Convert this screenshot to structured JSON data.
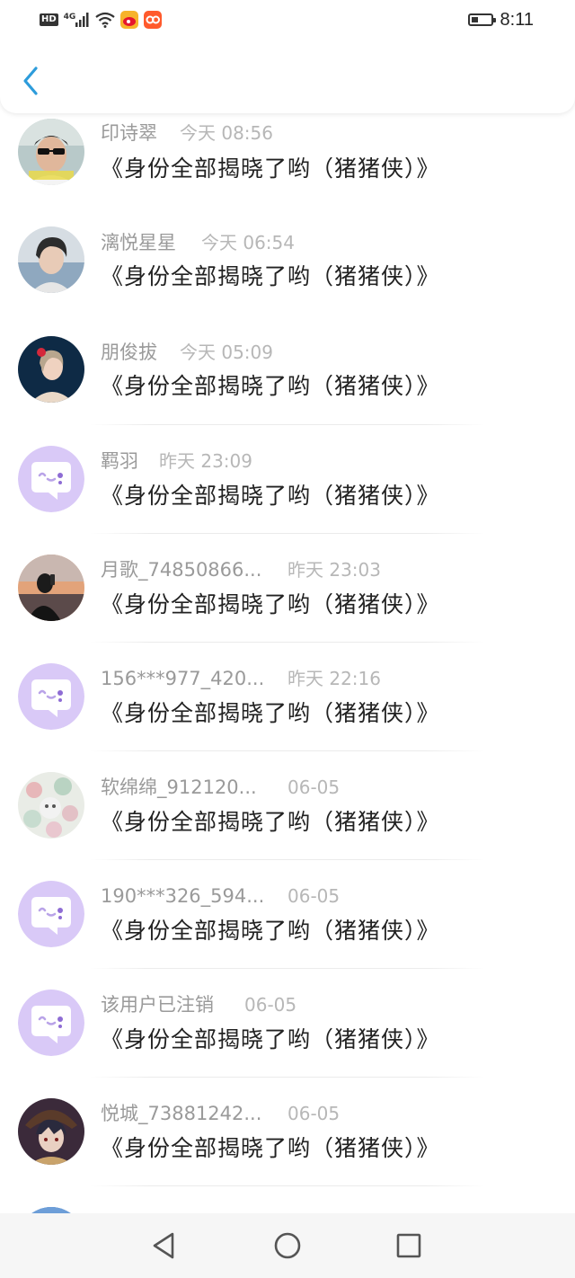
{
  "status_bar": {
    "network_hd": "HD",
    "network_gen": "4G",
    "time": "8:11",
    "battery_level": 0.35
  },
  "header": {
    "back_icon": "chevron-left-icon",
    "accent_color": "#2d9cdb"
  },
  "comments": [
    {
      "name": "印诗翠",
      "time": "今天 08:56",
      "message": "《身份全部揭晓了哟（猪猪侠）》",
      "avatar": "photo-man-sunglasses"
    },
    {
      "name": "漓悦星星",
      "time": "今天 06:54",
      "message": "《身份全部揭晓了哟（猪猪侠）》",
      "avatar": "photo-boy"
    },
    {
      "name": "朋俊拔",
      "time": "今天 05:09",
      "message": "《身份全部揭晓了哟（猪猪侠）》",
      "avatar": "photo-woman-flower"
    },
    {
      "name": "羁羽",
      "time": "昨天 23:09",
      "message": "《身份全部揭晓了哟（猪猪侠）》",
      "avatar": "default-chat-bubble"
    },
    {
      "name": "月歌_74850866...",
      "time": "昨天 23:03",
      "message": "《身份全部揭晓了哟（猪猪侠）》",
      "avatar": "photo-sunset"
    },
    {
      "name": "156***977_420...",
      "time": "昨天 22:16",
      "message": "《身份全部揭晓了哟（猪猪侠）》",
      "avatar": "default-chat-bubble"
    },
    {
      "name": "软绵绵_912120...",
      "time": "06-05",
      "message": "《身份全部揭晓了哟（猪猪侠）》",
      "avatar": "photo-floral"
    },
    {
      "name": "190***326_594...",
      "time": "06-05",
      "message": "《身份全部揭晓了哟（猪猪侠）》",
      "avatar": "default-chat-bubble"
    },
    {
      "name": "该用户已注销",
      "time": "06-05",
      "message": "《身份全部揭晓了哟（猪猪侠）》",
      "avatar": "default-chat-bubble"
    },
    {
      "name": "悦城_73881242...",
      "time": "06-05",
      "message": "《身份全部揭晓了哟（猪猪侠）》",
      "avatar": "photo-anime"
    }
  ],
  "nav_bar": {
    "back_icon": "triangle-back-icon",
    "home_icon": "circle-home-icon",
    "recents_icon": "square-recents-icon"
  }
}
